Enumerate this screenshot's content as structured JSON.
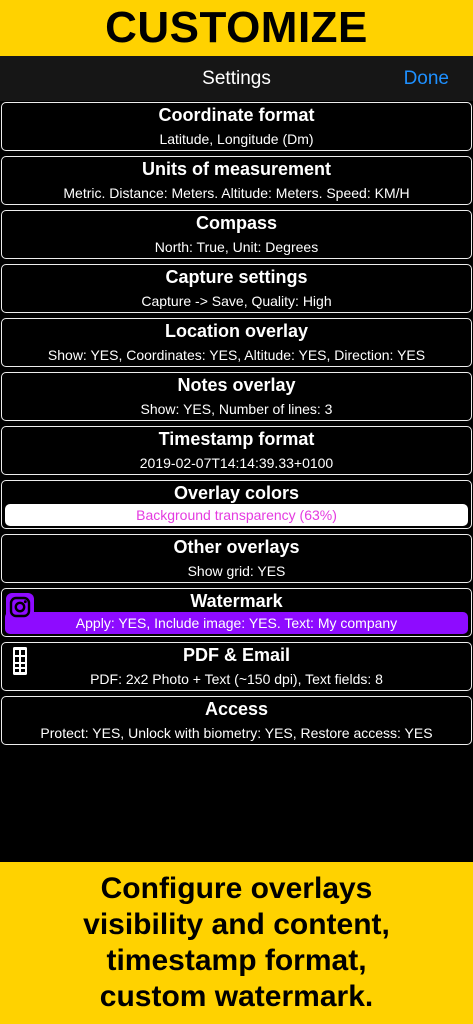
{
  "banner_top": {
    "title": "CUSTOMIZE"
  },
  "nav": {
    "title": "Settings",
    "done_label": "Done"
  },
  "settings": [
    {
      "title": "Coordinate format",
      "subtitle": "Latitude, Longitude (Dm)"
    },
    {
      "title": "Units of measurement",
      "subtitle": "Metric. Distance: Meters. Altitude: Meters. Speed: KM/H"
    },
    {
      "title": "Compass",
      "subtitle": "North: True, Unit: Degrees"
    },
    {
      "title": "Capture settings",
      "subtitle": "Capture -> Save, Quality: High"
    },
    {
      "title": "Location overlay",
      "subtitle": "Show: YES, Coordinates: YES, Altitude: YES, Direction: YES"
    },
    {
      "title": "Notes overlay",
      "subtitle": "Show: YES, Number of lines: 3"
    },
    {
      "title": "Timestamp format",
      "subtitle": "2019-02-07T14:14:39.33+0100"
    },
    {
      "title": "Overlay colors",
      "subtitle": "Background transparency (63%)",
      "background_transparency_percent": 63
    },
    {
      "title": "Other overlays",
      "subtitle": "Show grid: YES"
    },
    {
      "title": "Watermark",
      "subtitle": "Apply: YES, Include image: YES. Text: My company",
      "icon": "instagram-icon"
    },
    {
      "title": "PDF & Email",
      "subtitle": "PDF: 2x2 Photo + Text (~150 dpi), Text fields: 8",
      "icon": "pdf-layout-icon"
    },
    {
      "title": "Access",
      "subtitle": "Protect: YES, Unlock with biometry: YES, Restore access: YES"
    }
  ],
  "banner_bottom": {
    "lines": [
      "Configure overlays",
      "visibility and content,",
      "timestamp format,",
      "custom watermark."
    ]
  },
  "colors": {
    "banner": "#FFD200",
    "done": "#1E90FF",
    "watermark_pill": "#8E0BFF",
    "transparency_text": "#E43BE0"
  }
}
